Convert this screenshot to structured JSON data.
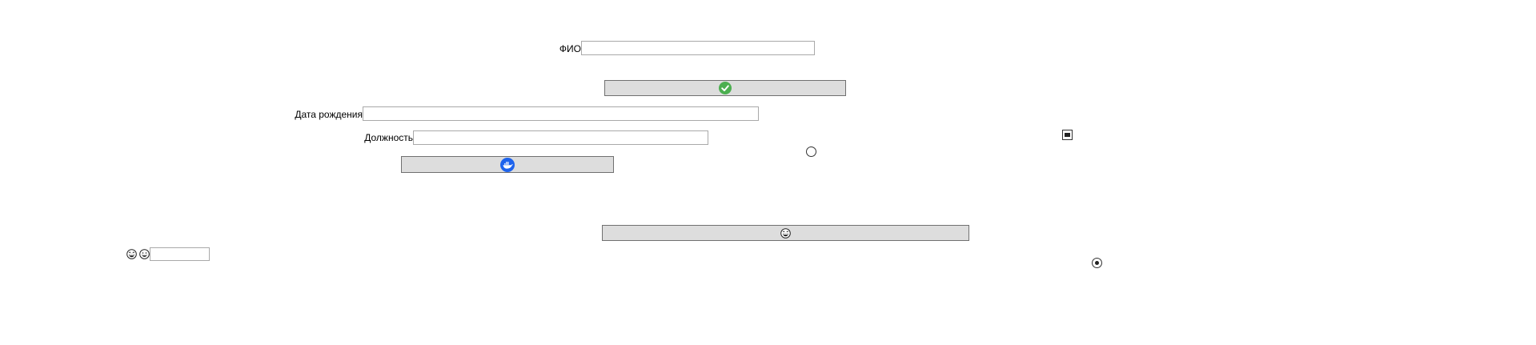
{
  "form": {
    "fio_label": "ФИО",
    "fio_value": "",
    "birth_label": "Дата рождения",
    "birth_value": "",
    "position_label": "Должность",
    "position_value": "",
    "small_input_value": ""
  },
  "buttons": {
    "confirm_icon": "check-circle-icon",
    "docker_icon": "docker-whale-icon",
    "laugh_icon": "laughing-face-icon"
  },
  "controls": {
    "radio_1_checked": false,
    "radio_2_checked": true,
    "checkbox_state": "indeterminate"
  },
  "icons": {
    "small_icon_1": "laughing-face-icon",
    "small_icon_2": "grinning-face-icon"
  },
  "colors": {
    "button_bg": "#dddddd",
    "check_green": "#4caf50",
    "docker_blue": "#1d63ed"
  }
}
